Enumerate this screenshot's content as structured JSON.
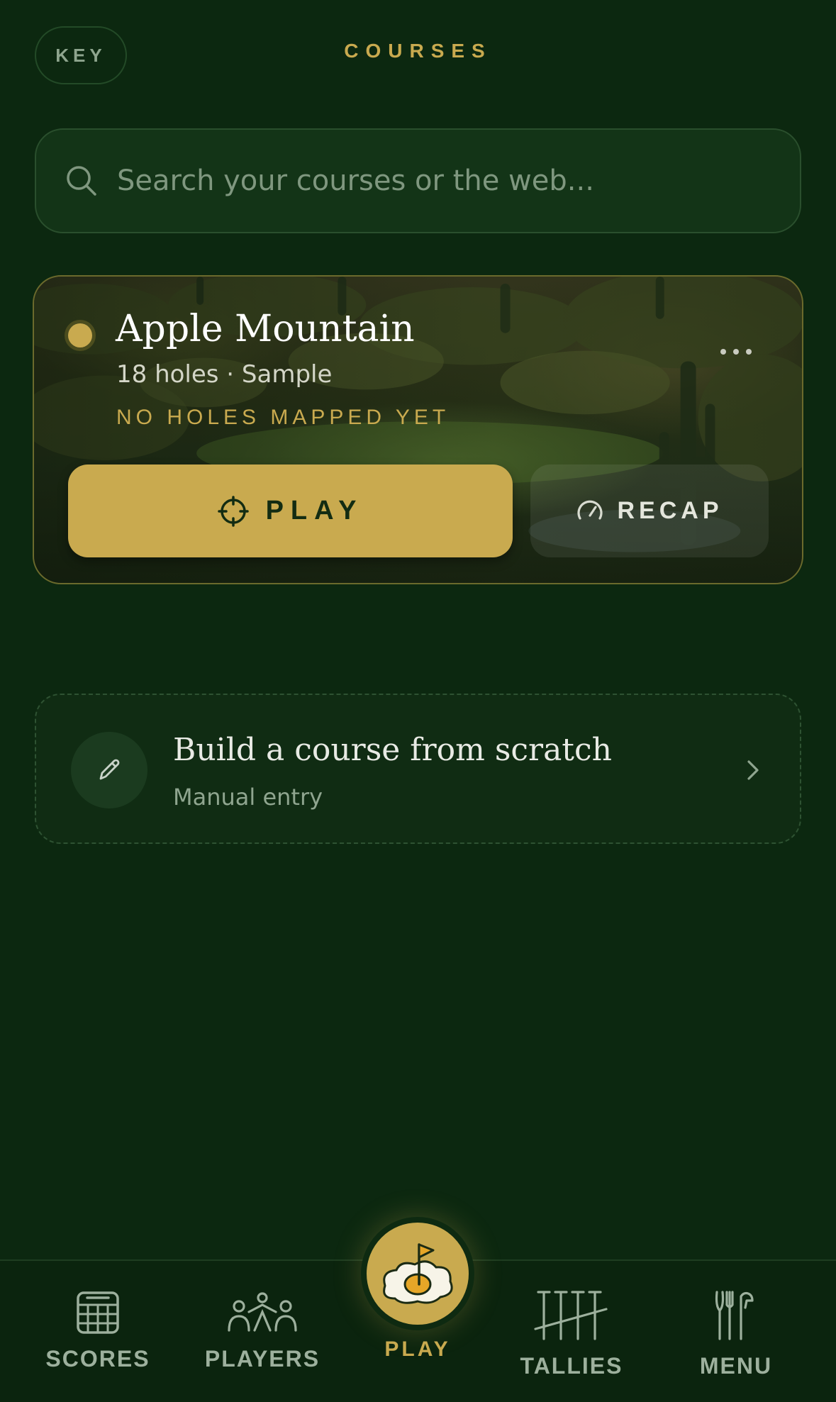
{
  "header": {
    "key_label": "KEY",
    "title": "COURSES"
  },
  "search": {
    "placeholder": "Search your courses or the web..."
  },
  "course": {
    "name": "Apple Mountain",
    "meta": "18 holes · Sample",
    "status": "NO HOLES MAPPED YET",
    "play_label": "PLAY",
    "recap_label": "RECAP"
  },
  "build": {
    "title": "Build a course from scratch",
    "subtitle": "Manual entry"
  },
  "nav": {
    "scores": "SCORES",
    "players": "PLAYERS",
    "play": "PLAY",
    "tallies": "TALLIES",
    "menu": "MENU"
  },
  "colors": {
    "background": "#0c2810",
    "accent_gold": "#c9aa4f",
    "muted_text": "#9db09d"
  },
  "icons": {
    "search": "search-icon",
    "more": "more-dots-icon",
    "play": "crosshair-icon",
    "recap": "gauge-icon",
    "build": "pencil-icon",
    "chevron": "chevron-right-icon",
    "scores": "scorecard-icon",
    "players": "players-icon",
    "play_nav": "egg-flag-icon",
    "tallies": "tees-icon",
    "menu": "utensils-club-icon"
  }
}
